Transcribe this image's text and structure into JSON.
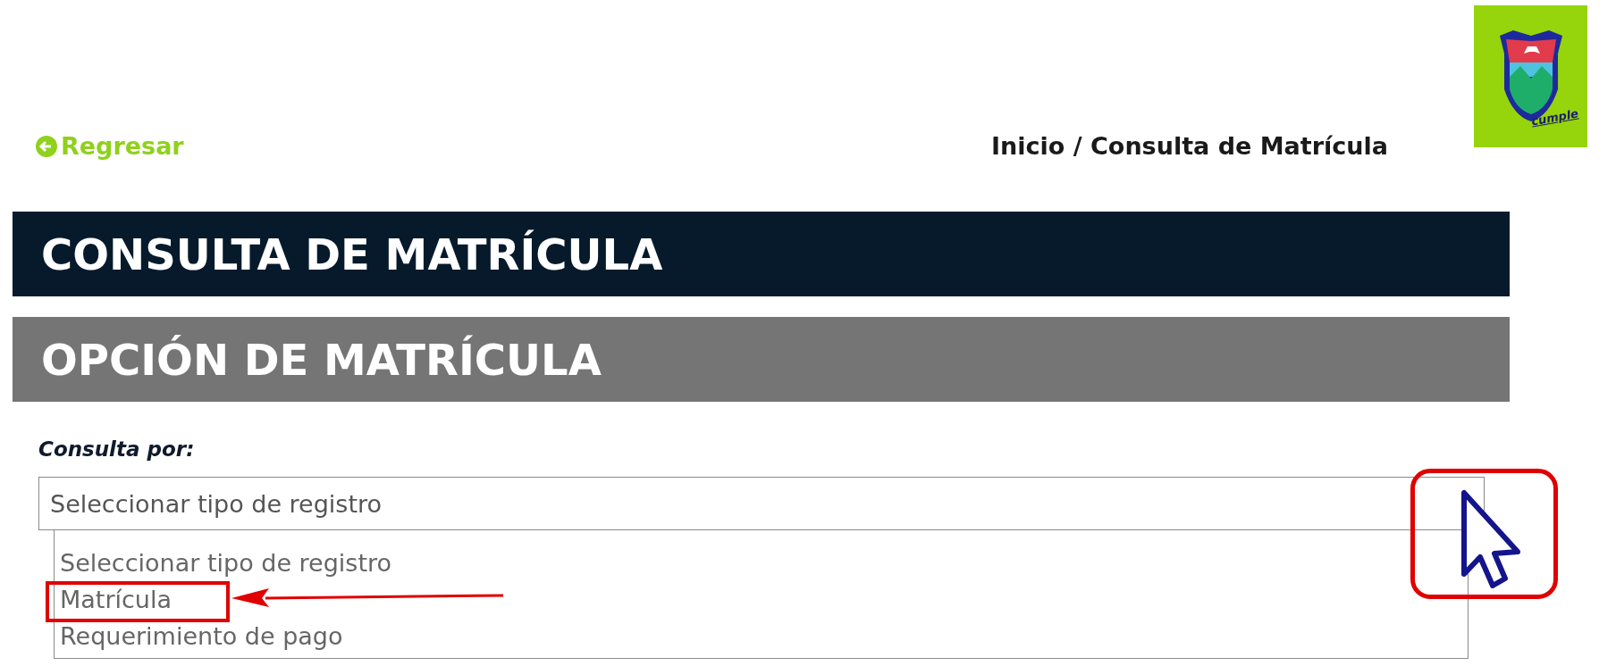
{
  "logo": {
    "caption": "cumple"
  },
  "nav": {
    "back_link": "Regresar",
    "breadcrumb": "Inicio / Consulta de Matrícula"
  },
  "page_title": "CONSULTA DE MATRÍCULA",
  "section_title": "OPCIÓN DE MATRÍCULA",
  "form": {
    "label": "Consulta por:",
    "select": {
      "value": "Seleccionar tipo de registro",
      "expanded": true,
      "options": [
        {
          "label": "Seleccionar tipo de registro",
          "highlighted": false
        },
        {
          "label": "Matrícula",
          "highlighted": true
        },
        {
          "label": "Requerimiento de pago",
          "highlighted": false
        }
      ]
    }
  },
  "cursor_highlight": true
}
